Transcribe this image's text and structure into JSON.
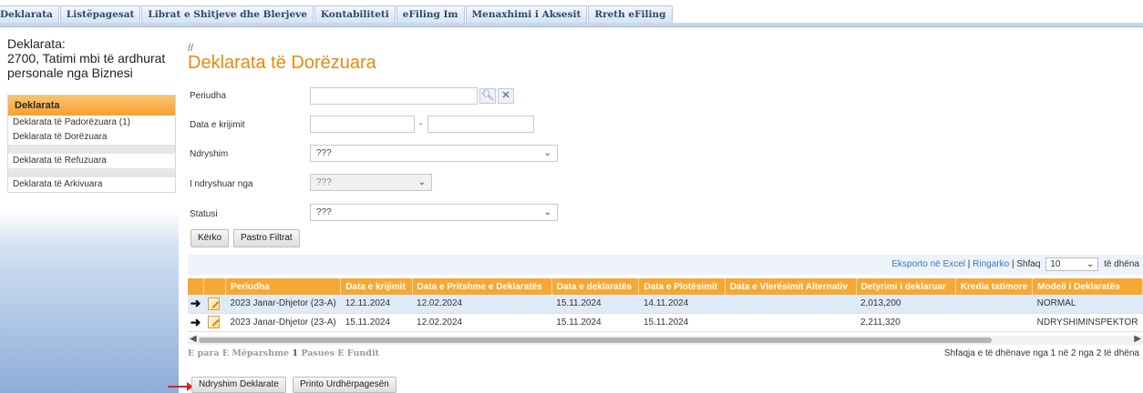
{
  "nav": {
    "tabs": [
      "Deklarata",
      "Listëpagesat",
      "Librat e Shitjeve dhe Blerjeve",
      "Kontabiliteti",
      "eFiling Im",
      "Menaxhimi i Aksesit",
      "Rreth eFiling"
    ]
  },
  "sidebar": {
    "title_1": "Deklarata:",
    "title_2": "2700, Tatimi mbi të ardhurat personale nga Biznesi",
    "menu_head": "Deklarata",
    "items": [
      "Deklarata të Padorëzuara (1)",
      "Deklarata të Dorëzuara",
      "Deklarata të Refuzuara",
      "Deklarata të Arkivuara"
    ]
  },
  "main": {
    "crumb": "//",
    "title": "Deklarata të Dorëzuara"
  },
  "filters": {
    "period_label": "Periudha",
    "created_label": "Data e krijimit",
    "dash": "-",
    "change_label": "Ndryshim",
    "change_value": "???",
    "changed_by_label": "I ndryshuar nga",
    "changed_by_value": "???",
    "status_label": "Statusi",
    "status_value": "???",
    "search_btn": "Kërko",
    "clear_btn": "Pastro Filtrat"
  },
  "toolbar": {
    "export": "Eksporto në Excel",
    "refresh": "Ringarko",
    "sep": "|",
    "show": "Shfaq",
    "page_size": "10",
    "data_suffix": "të dhëna"
  },
  "table": {
    "headers": [
      "",
      "",
      "Periudha",
      "Data e krijimit",
      "Data e Pritshme e Deklaratës",
      "Data e deklaratës",
      "Data e Plotësimit",
      "Data e Vlerësimit Alternativ",
      "Detyrimi i deklaruar",
      "Kredia tatimore",
      "Modeli i Deklaratës"
    ],
    "rows": [
      {
        "arrow": "➜",
        "period": "2023 Janar-Dhjetor (23-A)",
        "created": "12.11.2024",
        "expected": "12.02.2024",
        "declared": "15.11.2024",
        "completed": "14.11.2024",
        "alt": "",
        "liability": "2,013,200",
        "credit": "",
        "model": "NORMAL"
      },
      {
        "arrow": "➜",
        "period": "2023 Janar-Dhjetor (23-A)",
        "created": "15.11.2024",
        "expected": "12.02.2024",
        "declared": "15.11.2024",
        "completed": "15.11.2024",
        "alt": "",
        "liability": "2,211,320",
        "credit": "",
        "model": "NDRYSHIMINSPEKTOR"
      }
    ]
  },
  "pager": {
    "first": "E para",
    "prev": "E Mëparshme",
    "current": "1",
    "next": "Pasues",
    "last": "E Fundit",
    "showing": "Shfaqja e të dhënave nga 1 në 2 nga 2 të dhëna"
  },
  "actions": {
    "change_btn": "Ndryshim Deklarate",
    "print_btn": "Printo Urdhërpagesën"
  }
}
